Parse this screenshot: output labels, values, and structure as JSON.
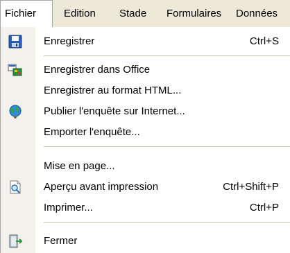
{
  "menubar": {
    "items": [
      {
        "label": "Fichier"
      },
      {
        "label": "Edition"
      },
      {
        "label": "Stade"
      },
      {
        "label": "Formulaires"
      },
      {
        "label": "Données"
      }
    ]
  },
  "menu": {
    "items": [
      {
        "label": "Enregistrer",
        "shortcut": "Ctrl+S",
        "icon": "save-icon"
      },
      {
        "label": "Enregistrer dans Office",
        "shortcut": "",
        "icon": "office-export-icon"
      },
      {
        "label": "Enregistrer au format HTML...",
        "shortcut": "",
        "icon": ""
      },
      {
        "label": "Publier l'enquête sur Internet...",
        "shortcut": "",
        "icon": "globe-icon"
      },
      {
        "label": "Emporter l'enquête...",
        "shortcut": "",
        "icon": ""
      },
      {
        "label": "Mise en page...",
        "shortcut": "",
        "icon": ""
      },
      {
        "label": "Aperçu avant impression",
        "shortcut": "Ctrl+Shift+P",
        "icon": "print-preview-icon"
      },
      {
        "label": "Imprimer...",
        "shortcut": "Ctrl+P",
        "icon": ""
      },
      {
        "label": "Fermer",
        "shortcut": "",
        "icon": "exit-door-icon"
      }
    ]
  }
}
